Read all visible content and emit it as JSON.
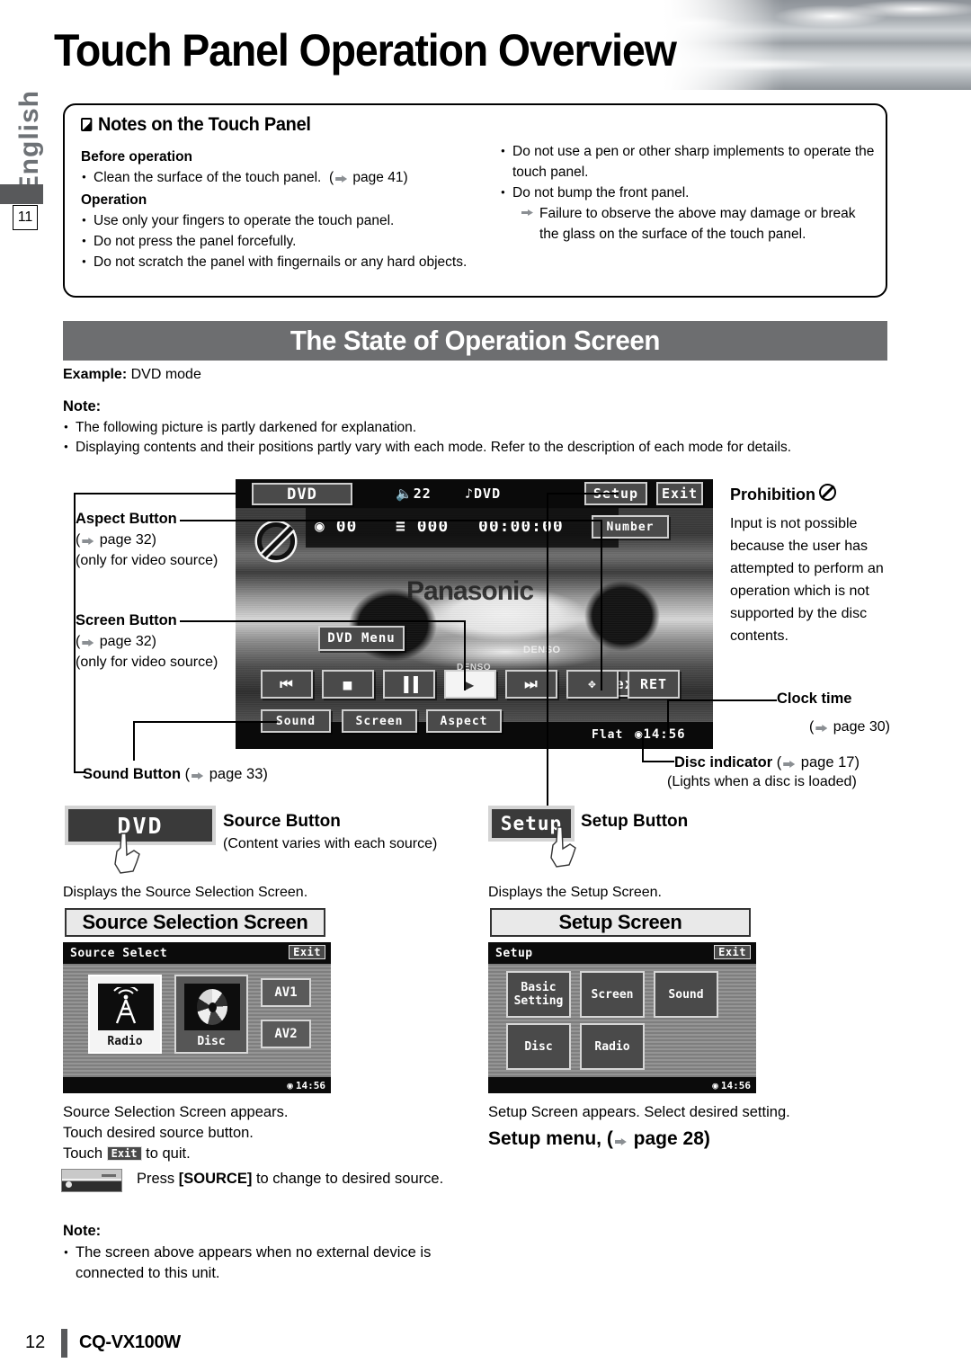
{
  "header": {
    "title": "Touch Panel Operation Overview",
    "language_tab": "English",
    "chapter_number": "11"
  },
  "notes_box": {
    "heading": "Notes on the Touch Panel",
    "left": {
      "before_operation_label": "Before operation",
      "before_items": [
        "Clean the surface of the touch panel.  (➜ page 41)"
      ],
      "operation_label": "Operation",
      "operation_items": [
        "Use only your fingers to operate the touch panel.",
        "Do not press the panel forcefully.",
        "Do not scratch the panel with fingernails or any hard objects."
      ]
    },
    "right": {
      "items": [
        "Do not use a pen or other sharp implements to operate the touch panel.",
        "Do not bump the front panel."
      ],
      "sub_arrow_item": "Failure to observe the above may damage or break the glass on the surface of the touch panel."
    }
  },
  "section": {
    "bar_title": "The State of Operation Screen",
    "example_bold": "Example:",
    "example_rest": " DVD mode",
    "note_label": "Note:",
    "note_items": [
      "The following picture is partly darkened for explanation.",
      "Displaying contents and their positions partly vary with each mode. Refer to the description of each mode for details."
    ]
  },
  "callouts": {
    "aspect": {
      "title": "Aspect Button",
      "page": "(➜ page 32)",
      "note": "(only for video source)"
    },
    "screen": {
      "title": "Screen Button",
      "page": "(➜ page 32)",
      "note": "(only for video source)"
    },
    "sound": {
      "title": "Sound Button",
      "page": "(➜ page 33)"
    },
    "prohibition": {
      "title": "Prohibition",
      "icon": "prohibition-icon",
      "body": "Input is not possible because the user has attempted to perform an operation which is not supported by the disc contents."
    },
    "clock": {
      "title": "Clock time",
      "page": "(➜ page 30)"
    },
    "disc": {
      "title": "Disc indicator",
      "page": "(➜ page 17)",
      "note": "(Lights when a disc is loaded)"
    }
  },
  "dvd_screen": {
    "source_button": "DVD",
    "volume": "22",
    "volume_icon": "speaker-icon",
    "music_source": "DVD",
    "music_icon": "note-icon",
    "setup_button": "Setup",
    "exit_button": "Exit",
    "title_number": "00",
    "title_icon": "disc-icon",
    "chapter_number": "000",
    "chapter_icon": "list-icon",
    "time_code": "00:00:00",
    "number_button": "Number",
    "dvd_menu_button": "DVD Menu",
    "next_button": "Next›",
    "transport": [
      "⏮",
      "■",
      "▐▐",
      "▶",
      "⏭"
    ],
    "cursor_button": "cursor-pad-icon",
    "ret_button": "RET",
    "bottom_buttons": [
      "Sound",
      "Screen",
      "Aspect"
    ],
    "eq_label": "Flat",
    "clock": "14:56",
    "photo_brand": "Panasonic",
    "photo_sponsor": "DENSO"
  },
  "source_row": {
    "button_label": "DVD",
    "title": "Source Button",
    "subtitle": "(Content varies with each source)",
    "displays": "Displays the Source Selection Screen."
  },
  "setup_row": {
    "button_label": "Setup",
    "title": "Setup Button",
    "displays": "Displays the Setup Screen."
  },
  "source_panel": {
    "panel_title": "Source Selection Screen",
    "screen_bar": "Source Select",
    "exit": "Exit",
    "tiles": [
      {
        "label": "Radio",
        "icon": "antenna-icon"
      },
      {
        "label": "Disc",
        "icon": "disc-icon"
      }
    ],
    "av_buttons": [
      "AV1",
      "AV2"
    ],
    "clock": "14:56",
    "body_lines": [
      "Source Selection Screen appears.",
      "Touch desired source button."
    ],
    "touch_prefix": "Touch ",
    "touch_chip": "Exit",
    "touch_suffix": " to quit.",
    "remote_icon": "remote-control-icon",
    "remote_text_pre": "Press ",
    "remote_text_key": "[SOURCE]",
    "remote_text_post": " to change to desired source.",
    "note_label": "Note:",
    "note_item": "The screen above appears when no external device is connected to this unit."
  },
  "setup_panel": {
    "panel_title": "Setup Screen",
    "screen_bar": "Setup",
    "exit": "Exit",
    "tiles": [
      "Basic\nSetting",
      "Screen",
      "Sound",
      "Disc",
      "Radio"
    ],
    "clock": "14:56",
    "body_line": "Setup Screen appears. Select desired setting.",
    "menu_line": "Setup menu, (➜ page 28)"
  },
  "footer": {
    "page_number": "12",
    "model": "CQ-VX100W"
  },
  "colors": {
    "section_bar": "#6d6e70",
    "sidebar_mark": "#58595b",
    "arrow": "#8b8f93",
    "screen_dark": "#0a0a0a",
    "tile_gray": "#4a4a4a"
  }
}
